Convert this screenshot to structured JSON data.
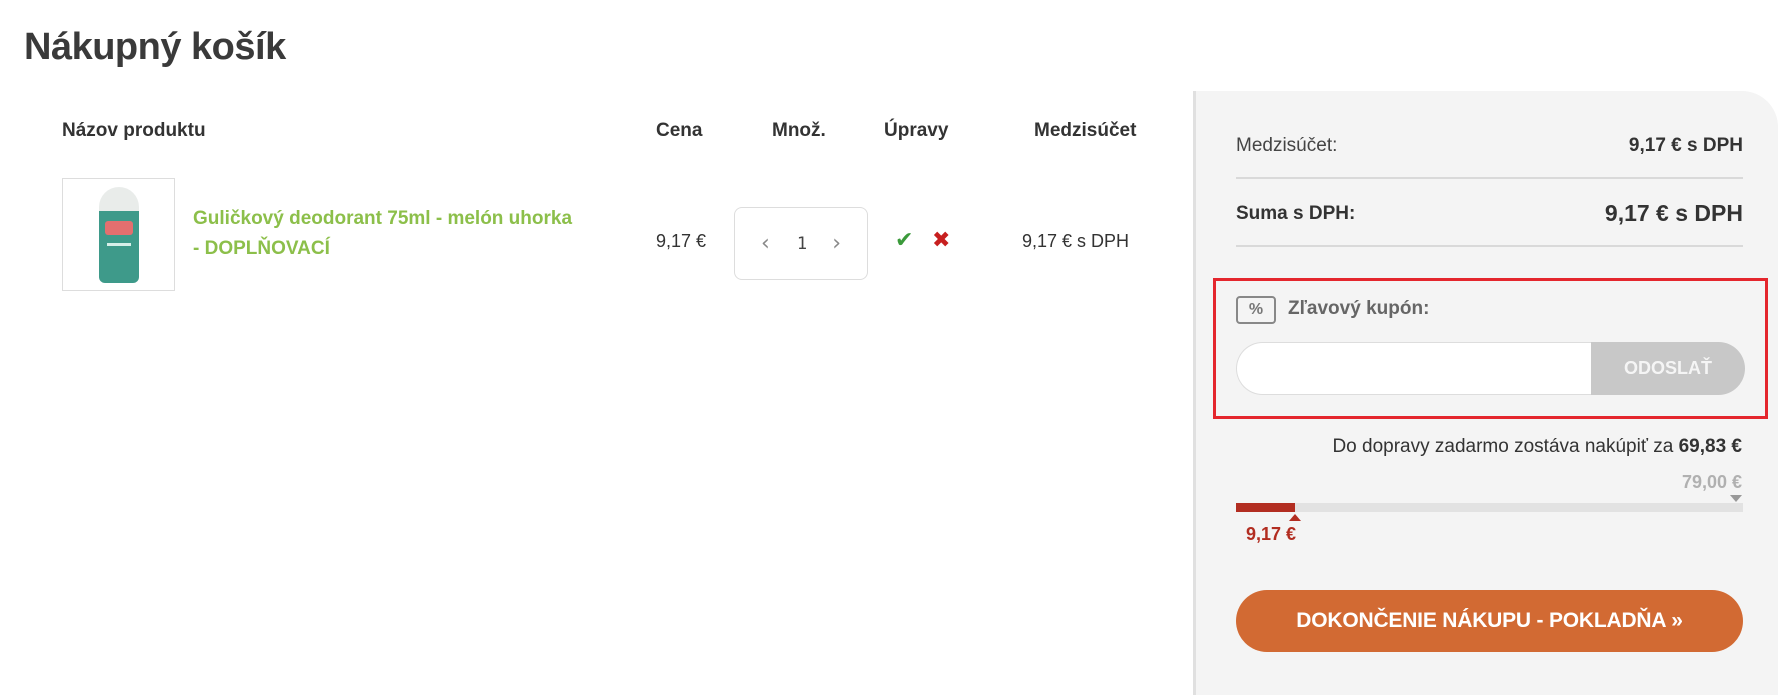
{
  "page": {
    "title": "Nákupný košík"
  },
  "table": {
    "headers": {
      "name": "Názov produktu",
      "price": "Cena",
      "qty": "Množ.",
      "edit": "Úpravy",
      "subtotal": "Medzisúčet"
    },
    "items": [
      {
        "name": "Guličkový deodorant 75ml - melón uhorka - DOPLŇOVACÍ",
        "price": "9,17 €",
        "quantity": "1",
        "subtotal": "9,17 € s DPH",
        "confirm_icon": "check-icon",
        "remove_icon": "close-icon"
      }
    ]
  },
  "summary": {
    "subtotal_label": "Medzisúčet:",
    "subtotal_value": "9,17 € s DPH",
    "total_label": "Suma s DPH:",
    "total_value": "9,17 € s DPH",
    "coupon": {
      "label": "Zľavový kupón:",
      "icon": "coupon-percent-icon",
      "input_value": "",
      "placeholder": "",
      "button": "ODOSLAŤ"
    },
    "shipping": {
      "text": "Do dopravy zadarmo zostáva nakúpiť za ",
      "remaining": "69,83 €",
      "threshold": "79,00 €",
      "current": "9,17 €",
      "progress_fraction": 0.116
    },
    "checkout": "DOKONČENIE NÁKUPU - POKLADŇA »"
  },
  "colors": {
    "product_link": "#8cbf4a",
    "checkout": "#d26a33",
    "progress": "#b22d21",
    "coupon_highlight": "#e4262d",
    "confirm": "#3b9a3b",
    "remove": "#c71f1f"
  }
}
